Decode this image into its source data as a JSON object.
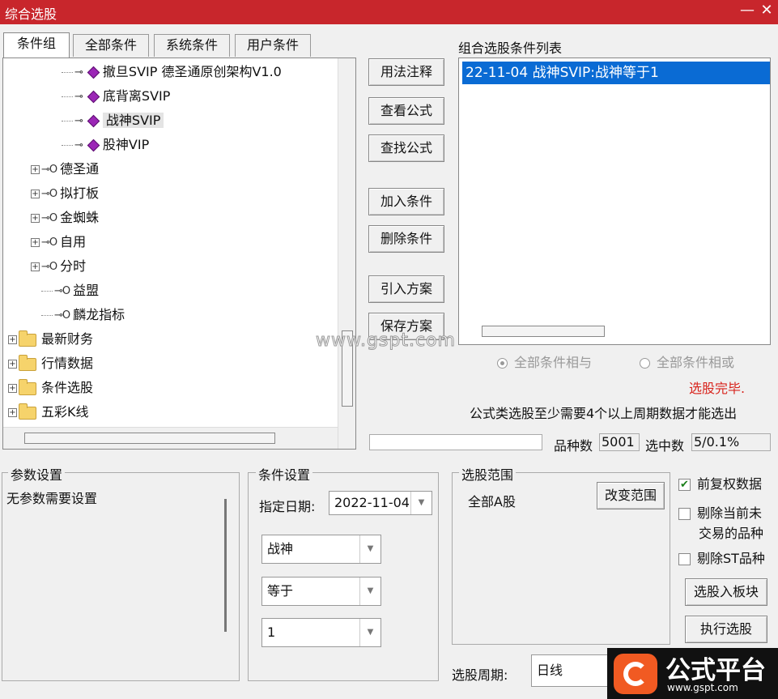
{
  "window": {
    "title": "综合选股",
    "min_label": "—",
    "close_label": "✕"
  },
  "tabs": [
    "条件组",
    "全部条件",
    "系统条件",
    "用户条件"
  ],
  "tree": {
    "sub_items": [
      "撤旦SVIP 德圣通原创架构V1.0",
      "底背离SVIP",
      "战神SVIP",
      "股神VIP"
    ],
    "groups": [
      "德圣通",
      "拟打板",
      "金蜘蛛",
      "自用",
      "分时",
      "益盟",
      "麟龙指标"
    ],
    "folders": [
      "最新财务",
      "行情数据",
      "条件选股",
      "五彩K线"
    ]
  },
  "buttons": {
    "usage": "用法注释",
    "view_formula": "查看公式",
    "find_formula": "查找公式",
    "add_condition": "加入条件",
    "delete_condition": "删除条件",
    "import_plan": "引入方案",
    "save_plan": "保存方案",
    "change_range": "改变范围",
    "to_block": "选股入板块",
    "execute": "执行选股"
  },
  "combo_list": {
    "title": "组合选股条件列表",
    "items": [
      "22-11-04 战神SVIP:战神等于1"
    ]
  },
  "watermark": "www.gspt.com",
  "logic": {
    "and_label": "全部条件相与",
    "or_label": "全部条件相或",
    "selected": "and"
  },
  "status": {
    "done": "选股完毕.",
    "notice": "公式类选股至少需要4个以上周期数据才能选出",
    "varieties_label": "品种数",
    "varieties_value": "5001",
    "selected_label": "选中数",
    "selected_value": "5/0.1%"
  },
  "params": {
    "title": "参数设置",
    "text": "无参数需要设置"
  },
  "condition_settings": {
    "title": "条件设置",
    "date_label": "指定日期:",
    "date_value": "2022-11-04",
    "select1": "战神",
    "select2": "等于",
    "select3": "1"
  },
  "range": {
    "title": "选股范围",
    "value": "全部A股"
  },
  "options": {
    "restore_rights": "前复权数据",
    "exclude_untraded_1": "剔除当前未",
    "exclude_untraded_2": "交易的品种",
    "exclude_st": "剔除ST品种"
  },
  "period": {
    "label": "选股周期:",
    "value": "日线"
  },
  "brand": {
    "name": "公式平台",
    "url": "www.gspt.com"
  },
  "colors": {
    "titlebar": "#c8262c",
    "selection": "#0a6bd4",
    "done": "#d8231c"
  }
}
